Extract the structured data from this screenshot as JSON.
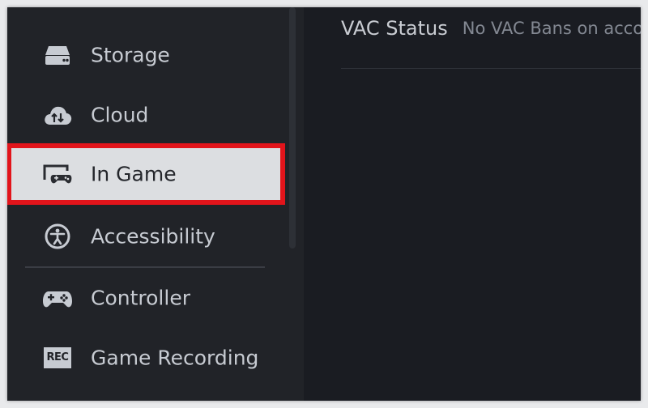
{
  "sidebar": {
    "items": [
      {
        "label": "Storage",
        "icon": "storage-icon"
      },
      {
        "label": "Cloud",
        "icon": "cloud-icon"
      },
      {
        "label": "In Game",
        "icon": "in-game-icon",
        "active": true
      },
      {
        "label": "Accessibility",
        "icon": "accessibility-icon"
      },
      {
        "label": "Controller",
        "icon": "controller-icon"
      },
      {
        "label": "Game Recording",
        "icon": "rec-icon",
        "icon_text": "REC"
      }
    ]
  },
  "main": {
    "vac_title": "VAC Status",
    "vac_value": "No VAC Bans on acco"
  },
  "colors": {
    "highlight_border": "#e2141b",
    "active_bg": "#dcdee1",
    "sidebar_bg": "#212328",
    "main_bg": "#1a1c22"
  }
}
